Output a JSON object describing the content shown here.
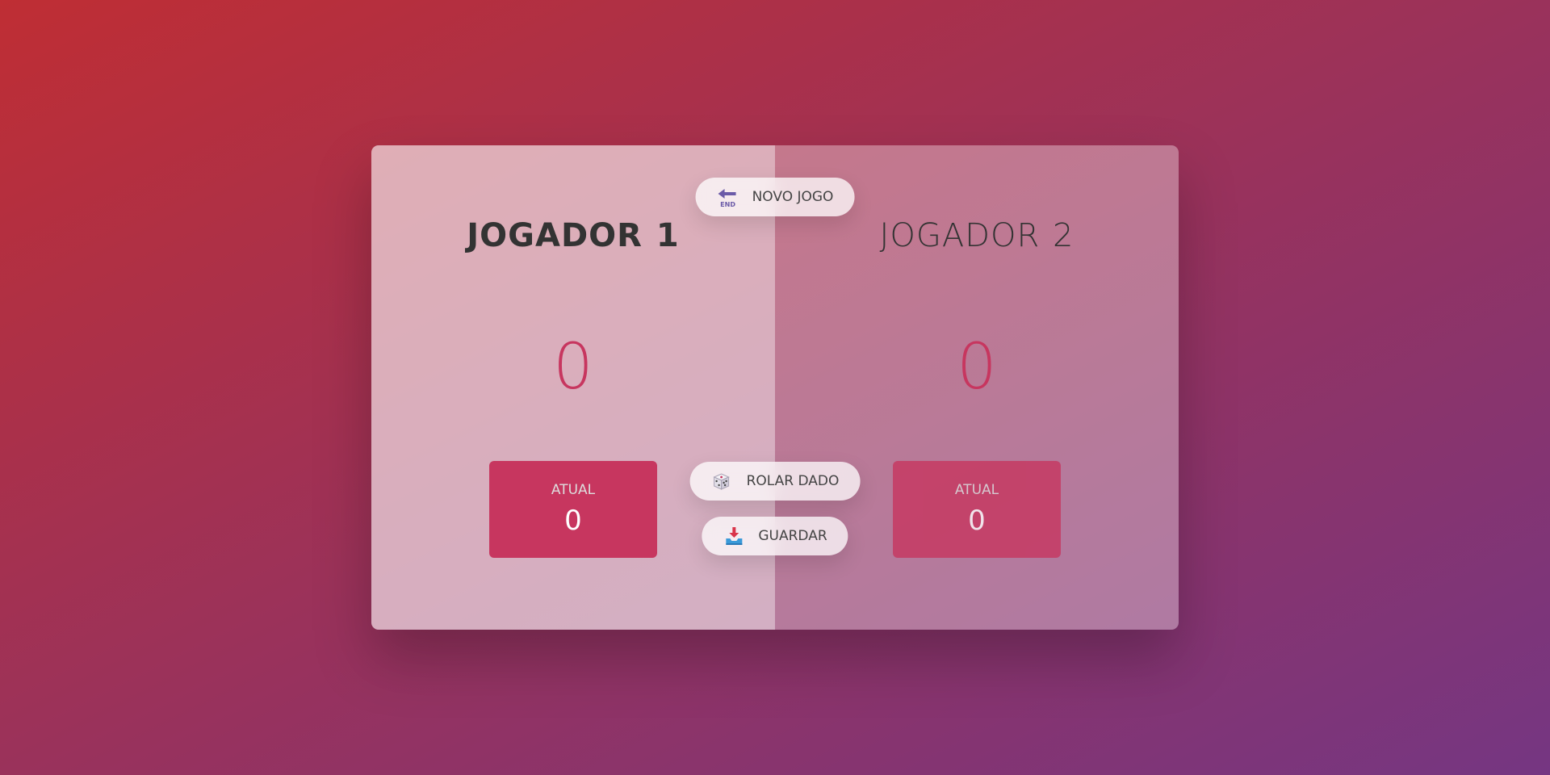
{
  "players": [
    {
      "name": "JOGADOR 1",
      "score": "0",
      "current_label": "ATUAL",
      "current_score": "0",
      "active": true
    },
    {
      "name": "JOGADOR 2",
      "score": "0",
      "current_label": "ATUAL",
      "current_score": "0",
      "active": false
    }
  ],
  "buttons": {
    "new_game": {
      "label": "NOVO JOGO",
      "icon": "end-arrow-icon"
    },
    "roll": {
      "label": "ROLAR DADO",
      "icon": "dice-icon"
    },
    "hold": {
      "label": "GUARDAR",
      "icon": "inbox-tray-icon"
    }
  },
  "colors": {
    "accent": "#c7365f",
    "background_start": "#bf2e34",
    "background_end": "#753682"
  }
}
